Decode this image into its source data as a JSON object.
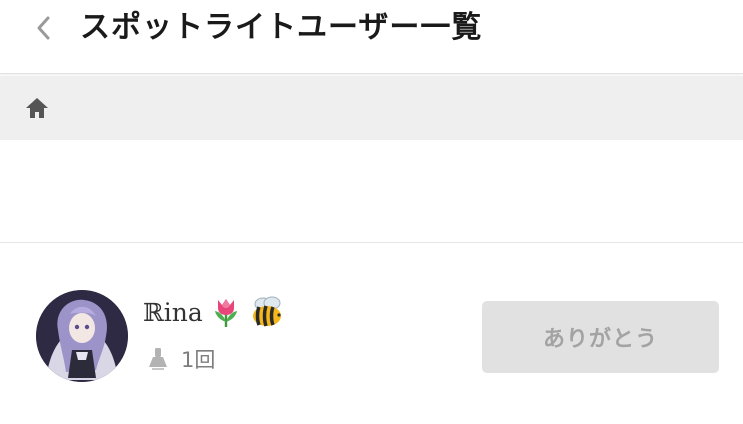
{
  "header": {
    "title": "スポットライトユーザー一覧",
    "back_icon": "chevron-left-icon"
  },
  "breadcrumb": {
    "home_icon": "home-icon"
  },
  "users": [
    {
      "name": "ℝina",
      "badges": [
        "tulip-icon",
        "bee-icon"
      ],
      "spotlight_count": "1回",
      "count_icon": "spotlight-icon",
      "action_label": "ありがとう",
      "action_enabled": false
    }
  ],
  "colors": {
    "title": "#1a1a1a",
    "breadcrumb_bg": "#efefef",
    "button_bg": "#e1e1e1",
    "button_text": "#a3a3a3",
    "count_text": "#7d7d7d"
  }
}
